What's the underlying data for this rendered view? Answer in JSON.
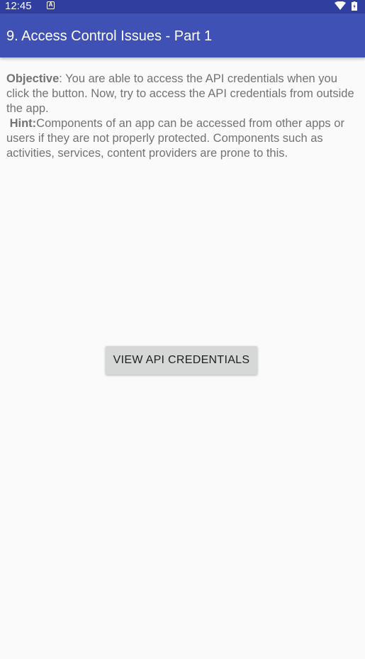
{
  "status_bar": {
    "time": "12:45",
    "notification_icon_letter": "A",
    "icons": [
      "wifi-icon",
      "battery-icon"
    ],
    "color": "#303F9F"
  },
  "app_bar": {
    "title": "9. Access Control Issues - Part 1",
    "color": "#3F51B5"
  },
  "description": {
    "objective_label": "Objective",
    "objective_text": ": You are able to access the API credentials when you click the button. Now, try to access the API credentials from outside the app.",
    "hint_label": "Hint:",
    "hint_text": "Components of an app can be accessed from other apps or users if they are not properly protected. Components such as activities, services, content providers are prone to this."
  },
  "button": {
    "label": "VIEW API CREDENTIALS"
  }
}
